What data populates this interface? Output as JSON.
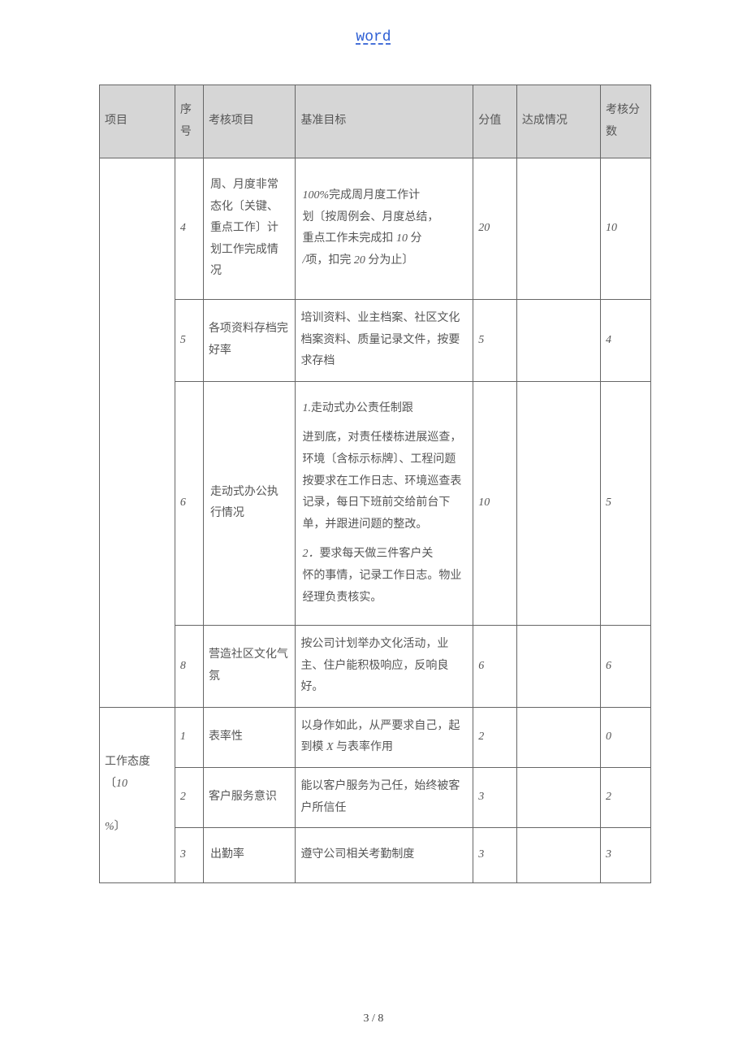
{
  "header": {
    "link_text": "word"
  },
  "table": {
    "headers": {
      "project": "项目",
      "no": "序号",
      "item": "考核项目",
      "standard": "基准目标",
      "score": "分值",
      "reach": "达成情况",
      "assess": "考核分数"
    },
    "section1": {
      "project": "",
      "rows": [
        {
          "no": "4",
          "item": "周、月度非常态化〔关键、重点工作〕计划工作完成情况",
          "standard_parts": {
            "p1a": "100%",
            "p1b": "完成周月度工作计",
            "p2a": "划〔按周例会、月度总结，",
            "p3a": "重点工作未完成扣 ",
            "p3b": "10",
            "p3c": " 分",
            "p4a": "/",
            "p4b": "项，扣完 ",
            "p4c": "20",
            "p4d": " 分为止〕"
          },
          "score": "20",
          "reach": "",
          "assess": "10"
        },
        {
          "no": "5",
          "item": "各项资料存档完好率",
          "standard": "培训资料、业主档案、社区文化档案资料、质量记录文件，按要求存档",
          "score": "5",
          "reach": "",
          "assess": "4"
        },
        {
          "no": "6",
          "item": "走动式办公执行情况",
          "standard_parts": {
            "p1a": "1.",
            "p1b": "走动式办公责任制跟",
            "p2": "进到底，对责任楼栋进展巡查，环境〔含标示标牌〕、工程问题按要求在工作日志、环境巡查表记录，每日下班前交给前台下单，并跟进问题的整改。",
            "p3a": "2．",
            "p3b": "要求每天做三件客户关",
            "p4": "怀的事情，记录工作日志。物业经理负责核实。"
          },
          "score": "10",
          "reach": "",
          "assess": "5"
        },
        {
          "no": "8",
          "item": "营造社区文化气氛",
          "standard": "按公司计划举办文化活动，业主、住户能积极响应，反响良好。",
          "score": "6",
          "reach": "",
          "assess": "6"
        }
      ]
    },
    "section2": {
      "project_parts": {
        "a": "工作态度〔",
        "b": "10",
        "c": "%",
        "d": "〕"
      },
      "rows": [
        {
          "no": "1",
          "item": "表率性",
          "standard_parts": {
            "a": "以身作如此，从严要求自己，起到模 ",
            "b": "X",
            "c": " 与表率作用"
          },
          "score": "2",
          "reach": "",
          "assess": "0"
        },
        {
          "no": "2",
          "item": "客户服务意识",
          "standard": "能以客户服务为己任，始终被客户所信任",
          "score": "3",
          "reach": "",
          "assess": "2"
        },
        {
          "no": "3",
          "item": "出勤率",
          "standard": "遵守公司相关考勤制度",
          "score": "3",
          "reach": "",
          "assess": "3"
        }
      ]
    }
  },
  "footer": {
    "page": "3 / 8"
  }
}
